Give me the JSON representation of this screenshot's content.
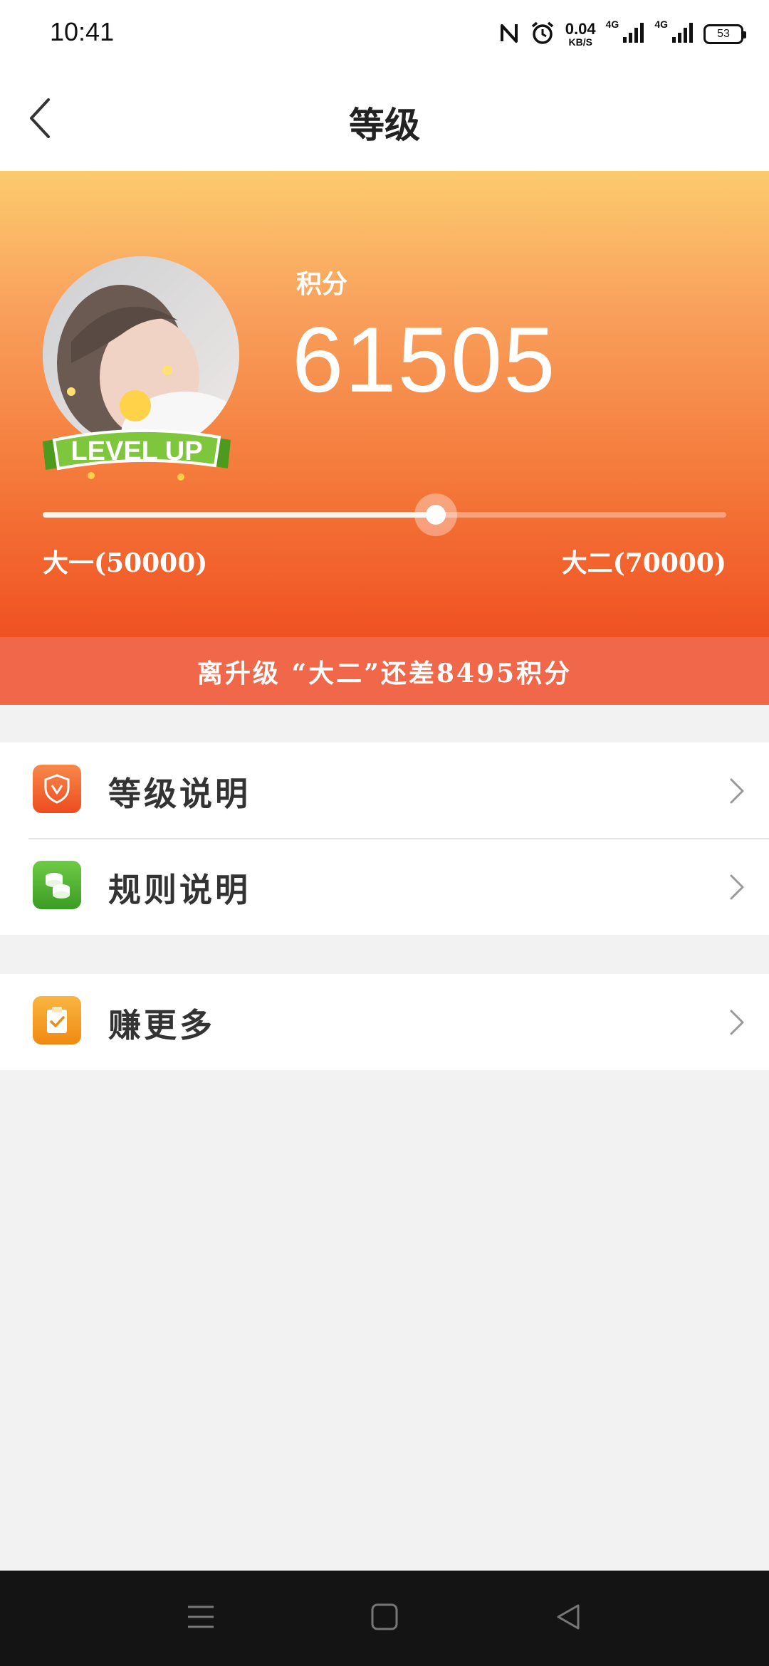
{
  "status_bar": {
    "time": "10:41",
    "net_speed_value": "0.04",
    "net_speed_unit": "KB/S",
    "sim1_label": "4G",
    "sim2_label": "4G",
    "battery": "53",
    "icons": [
      "nfc-icon",
      "alarm-icon",
      "signal-icon",
      "signal-icon",
      "battery-icon"
    ]
  },
  "header": {
    "title": "等级",
    "back_icon": "chevron-left-icon"
  },
  "hero": {
    "colors": {
      "top": "#fccb6e",
      "bottom": "#f05122"
    },
    "badge_text": "LEVEL UP",
    "score_label": "积分",
    "score_value": "61505",
    "progress_fraction": 0.5753,
    "level_start": "大一(50000)",
    "level_end": "大二(70000)"
  },
  "upgrade_notice": "离升级 “大二”还差8495积分",
  "menu": {
    "items": [
      {
        "label": "等级说明",
        "icon": "shield-icon",
        "color": "#f05a2a"
      },
      {
        "label": "规则说明",
        "icon": "coins-icon",
        "color": "#4aae35"
      },
      {
        "label": "赚更多",
        "icon": "clipboard-check-icon",
        "color": "#f39a1e"
      }
    ]
  },
  "nav_bar": {
    "buttons": [
      "menu-icon",
      "home-icon",
      "back-icon"
    ]
  }
}
